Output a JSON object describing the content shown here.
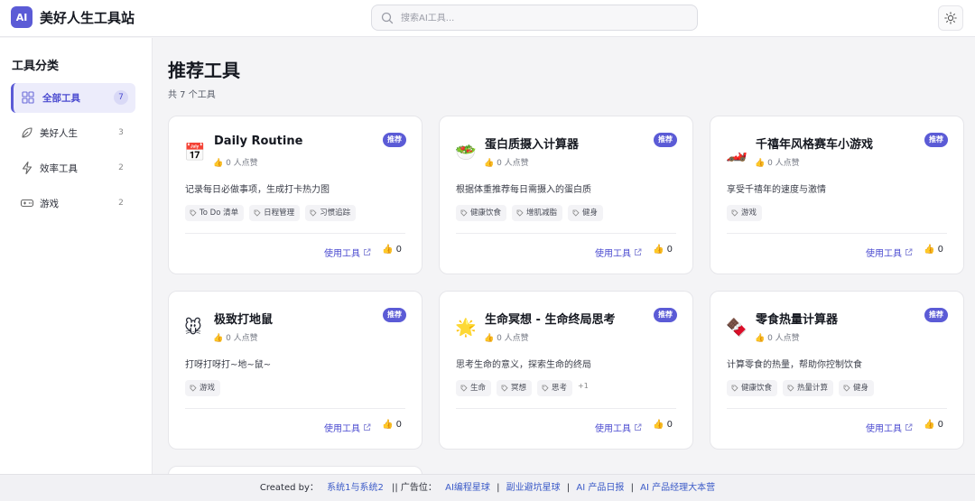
{
  "header": {
    "logo_text": "AI",
    "app_title": "美好人生工具站",
    "search_placeholder": "搜索AI工具...",
    "theme_icon": "sun-icon"
  },
  "sidebar": {
    "title": "工具分类",
    "items": [
      {
        "label": "全部工具",
        "count": "7",
        "icon": "grid-icon",
        "active": true
      },
      {
        "label": "美好人生",
        "count": "3",
        "icon": "leaf-icon"
      },
      {
        "label": "效率工具",
        "count": "2",
        "icon": "lightning-icon"
      },
      {
        "label": "游戏",
        "count": "2",
        "icon": "gamepad-icon"
      }
    ]
  },
  "main": {
    "title": "推荐工具",
    "subtitle": "共 7 个工具",
    "use_label": "使用工具",
    "badge_label": "推荐",
    "likes_label": "0 人点赞",
    "cards": [
      {
        "emoji": "📅",
        "title": "Daily Routine",
        "desc": "记录每日必做事项，生成打卡热力图",
        "tags": [
          "To Do 清单",
          "日程管理",
          "习惯追踪"
        ],
        "more": "",
        "likes": "0"
      },
      {
        "emoji": "🥗",
        "title": "蛋白质摄入计算器",
        "desc": "根据体重推荐每日需摄入的蛋白质",
        "tags": [
          "健康饮食",
          "增肌减脂",
          "健身"
        ],
        "more": "",
        "likes": "0"
      },
      {
        "emoji": "🏎️",
        "title": "千禧年风格赛车小游戏",
        "desc": "享受千禧年的速度与激情",
        "tags": [
          "游戏"
        ],
        "more": "",
        "likes": "0"
      },
      {
        "emoji": "🐭",
        "title": "极致打地鼠",
        "desc": "打呀打呀打~地~鼠~",
        "tags": [
          "游戏"
        ],
        "more": "",
        "likes": "0"
      },
      {
        "emoji": "🌟",
        "title": "生命冥想 - 生命终局思考",
        "desc": "思考生命的意义，探索生命的终局",
        "tags": [
          "生命",
          "冥想",
          "思考"
        ],
        "more": "+1",
        "likes": "0"
      },
      {
        "emoji": "🍫",
        "title": "零食热量计算器",
        "desc": "计算零食的热量，帮助你控制饮食",
        "tags": [
          "健康饮食",
          "热量计算",
          "健身"
        ],
        "more": "",
        "likes": "0"
      }
    ]
  },
  "footer": {
    "created_by": "Created by：",
    "author_link": "系统1与系统2",
    "ad_label": "|| 广告位：",
    "links": [
      "AI编程星球",
      "副业避坑星球",
      "AI 产品日报",
      "AI 产品经理大本营"
    ],
    "separator": "|"
  },
  "colors": {
    "accent": "#5b5bd6",
    "link": "#3c5bc8",
    "background": "#f4f4f6"
  }
}
